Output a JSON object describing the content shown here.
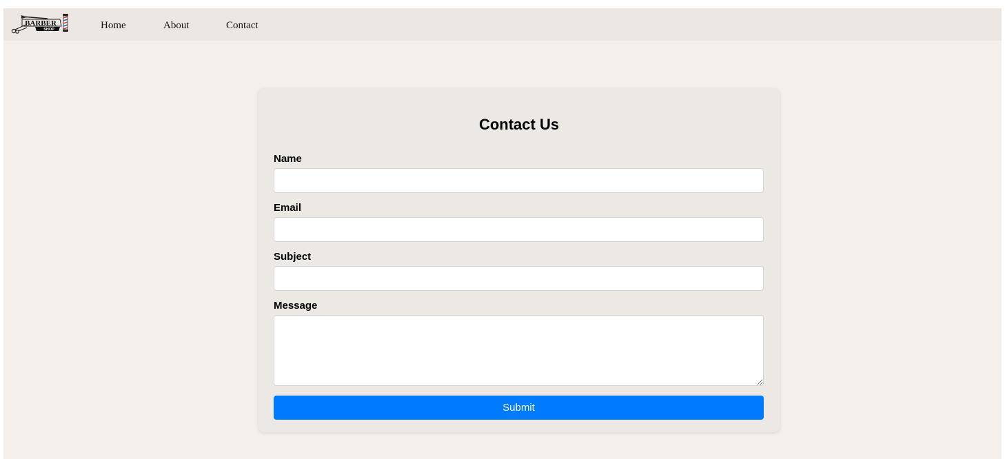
{
  "brand": {
    "logo_text_top": "BARBER",
    "logo_text_bottom": "SHOP",
    "logo_icons": [
      "scissors-icon",
      "barber-pole-icon"
    ]
  },
  "nav": {
    "items": [
      {
        "label": "Home"
      },
      {
        "label": "About"
      },
      {
        "label": "Contact"
      }
    ]
  },
  "form": {
    "title": "Contact Us",
    "fields": [
      {
        "label": "Name",
        "value": "",
        "placeholder": ""
      },
      {
        "label": "Email",
        "value": "",
        "placeholder": ""
      },
      {
        "label": "Subject",
        "value": "",
        "placeholder": ""
      },
      {
        "label": "Message",
        "value": "",
        "placeholder": ""
      }
    ],
    "submit_label": "Submit"
  },
  "colors": {
    "page_background": "#f4efeb",
    "navbar_background": "#ece7e2",
    "card_background": "#ece8e4",
    "accent": "#007bff",
    "pole_red": "#c0392b",
    "pole_blue": "#2c5aa0"
  }
}
